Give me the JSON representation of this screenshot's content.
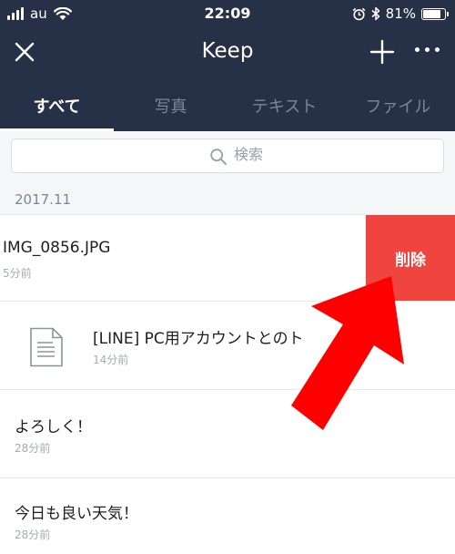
{
  "status_bar": {
    "carrier": "au",
    "time": "22:09",
    "battery": "81%",
    "battery_level": 0.81
  },
  "header": {
    "title": "Keep",
    "close_icon": "close-icon",
    "add_icon": "plus-icon",
    "more_icon": "more-dots-icon"
  },
  "tabs": [
    {
      "label": "すべて",
      "active": true
    },
    {
      "label": "写真",
      "active": false
    },
    {
      "label": "テキスト",
      "active": false
    },
    {
      "label": "ファイル",
      "active": false
    }
  ],
  "search": {
    "placeholder": "検索"
  },
  "section": {
    "date": "2017.11"
  },
  "items": [
    {
      "title": "IMG_0856.JPG",
      "time": "5分前"
    },
    {
      "title": "[LINE] PC用アカウントとのト",
      "time": "14分前"
    },
    {
      "title": "よろしく！",
      "time": "28分前"
    },
    {
      "title": "今日も良い天気！",
      "time": "28分前"
    }
  ],
  "actions": {
    "delete_label": "削除"
  },
  "colors": {
    "header_bg": "#263148",
    "delete_bg": "#f0443e",
    "arrow": "#ff0000"
  }
}
